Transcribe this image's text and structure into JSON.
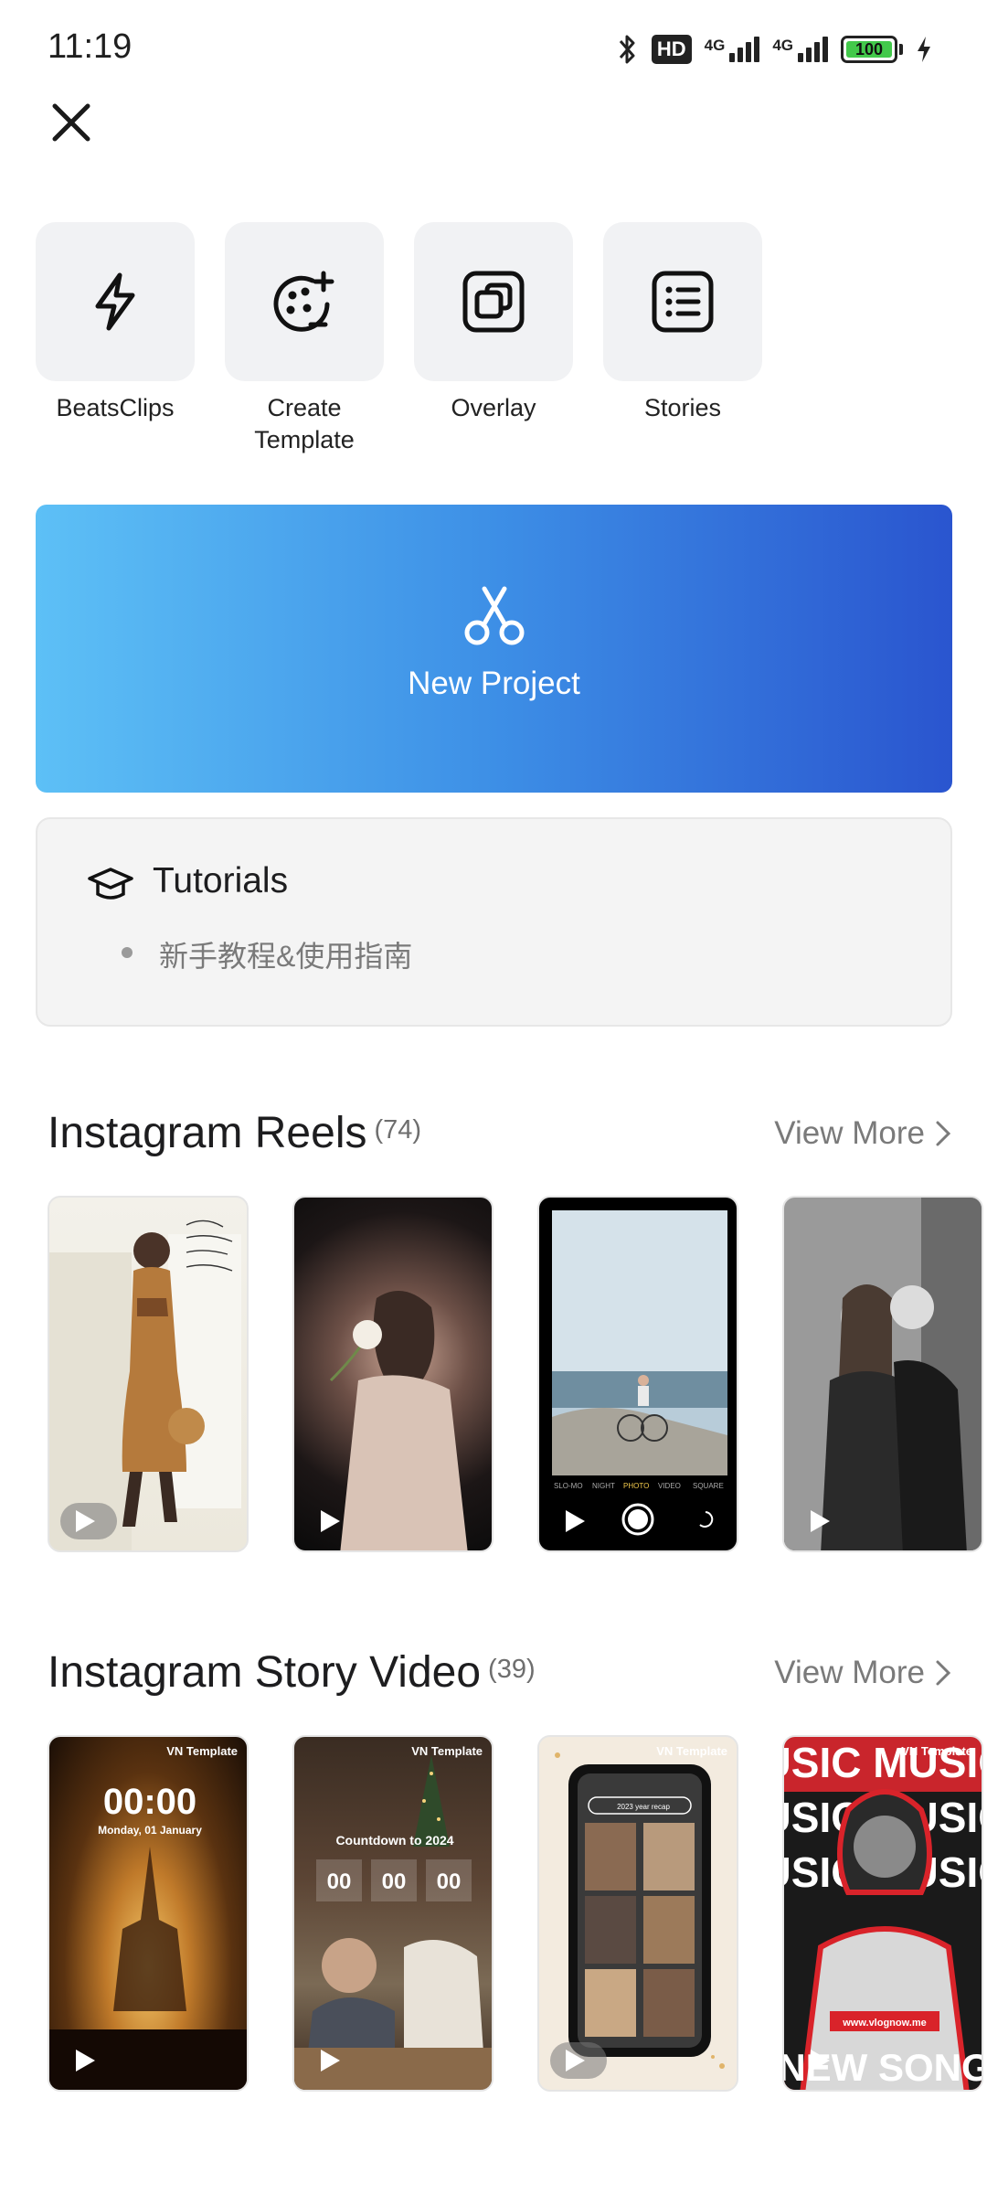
{
  "status_bar": {
    "time": "11:19",
    "hd_badge": "HD",
    "network_1": "4G",
    "network_2": "4G",
    "battery": "100"
  },
  "tools": [
    {
      "label": "BeatsClips",
      "icon": "lightning-icon"
    },
    {
      "label": "Create\nTemplate",
      "icon": "palette-plus-icon"
    },
    {
      "label": "Overlay",
      "icon": "overlay-icon"
    },
    {
      "label": "Stories",
      "icon": "list-icon"
    }
  ],
  "new_project": {
    "label": "New Project",
    "icon": "scissors-icon"
  },
  "tutorials": {
    "title": "Tutorials",
    "items": [
      "新手教程&使用指南"
    ]
  },
  "sections": [
    {
      "title": "Instagram Reels",
      "count": "(74)",
      "view_more": "View More"
    },
    {
      "title": "Instagram Story Video",
      "count": "(39)",
      "view_more": "View More"
    }
  ],
  "story_thumbs": {
    "tag": "VN Template",
    "timer_1": "00:00",
    "date_1": "Monday, 01 January",
    "countdown_title": "Countdown to 2024",
    "countdown_digits": [
      "00",
      "00",
      "00"
    ],
    "recap_label": "2023 year recap",
    "music_text": "USIC MUSIC",
    "music_url": "www.vlognow.me",
    "new_song": "NEW SONG"
  },
  "camera_modes": [
    "SLO-MO",
    "NIGHT",
    "PHOTO",
    "VIDEO",
    "SQUARE"
  ],
  "colors": {
    "gradient_start": "#5dc0f6",
    "gradient_end": "#2a55cf",
    "tool_bg": "#f1f2f4"
  }
}
